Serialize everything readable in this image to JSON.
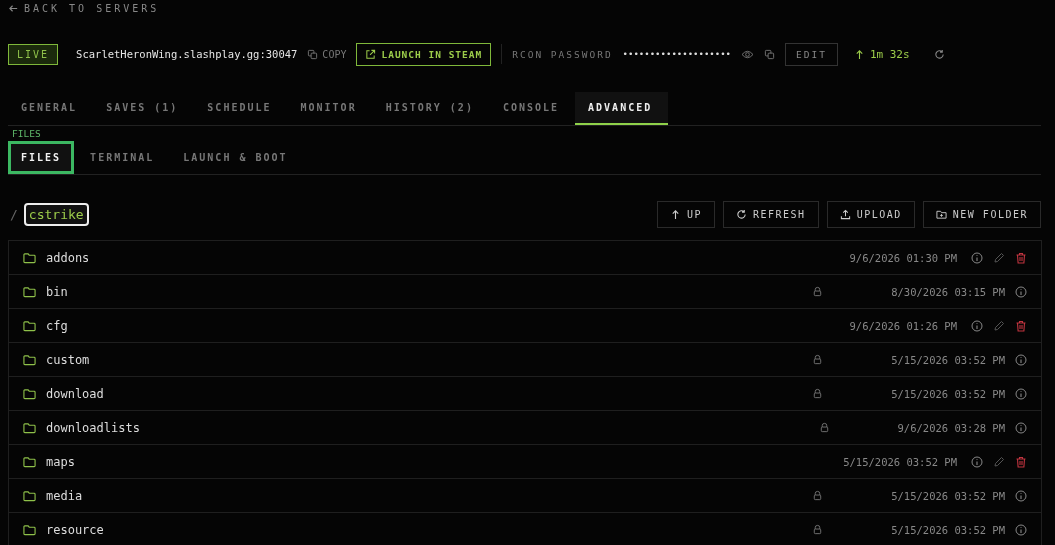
{
  "back_link": "BACK TO SERVERS",
  "server": {
    "status": "LIVE",
    "address": "ScarletHeronWing.slashplay.gg:30047",
    "copy_label": "COPY",
    "launch_label": "LAUNCH IN STEAM",
    "rcon_label": "RCON PASSWORD",
    "rcon_value": "••••••••••••••••••••",
    "edit_label": "EDIT",
    "uptime": "1m 32s"
  },
  "tabs": [
    {
      "label": "GENERAL",
      "selected": false
    },
    {
      "label": "SAVES (1)",
      "selected": false
    },
    {
      "label": "SCHEDULE",
      "selected": false
    },
    {
      "label": "MONITOR",
      "selected": false
    },
    {
      "label": "HISTORY (2)",
      "selected": false
    },
    {
      "label": "CONSOLE",
      "selected": false
    },
    {
      "label": "ADVANCED",
      "selected": true
    }
  ],
  "section_label": "FILES",
  "subtabs": [
    {
      "label": "FILES",
      "selected": true
    },
    {
      "label": "TERMINAL",
      "selected": false
    },
    {
      "label": "LAUNCH & BOOT",
      "selected": false
    }
  ],
  "breadcrumb": {
    "separator": "/",
    "folder": "cstrike"
  },
  "toolbar": [
    "UP",
    "REFRESH",
    "UPLOAD",
    "NEW FOLDER"
  ],
  "files": [
    {
      "name": "addons",
      "modified": "9/6/2026 01:30 PM",
      "locked": false
    },
    {
      "name": "bin",
      "modified": "8/30/2026 03:15 PM",
      "locked": true
    },
    {
      "name": "cfg",
      "modified": "9/6/2026 01:26 PM",
      "locked": false
    },
    {
      "name": "custom",
      "modified": "5/15/2026 03:52 PM",
      "locked": true
    },
    {
      "name": "download",
      "modified": "5/15/2026 03:52 PM",
      "locked": true
    },
    {
      "name": "downloadlists",
      "modified": "9/6/2026 03:28 PM",
      "locked": true
    },
    {
      "name": "maps",
      "modified": "5/15/2026 03:52 PM",
      "locked": false
    },
    {
      "name": "media",
      "modified": "5/15/2026 03:52 PM",
      "locked": true
    },
    {
      "name": "resource",
      "modified": "5/15/2026 03:52 PM",
      "locked": true
    }
  ]
}
